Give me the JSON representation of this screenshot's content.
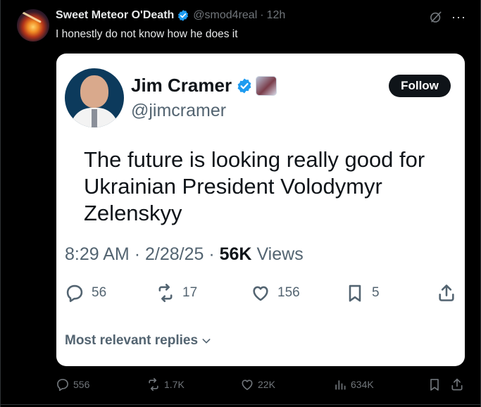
{
  "outer_tweet": {
    "author_name": "Sweet Meteor O'Death",
    "handle": "@smod4real",
    "separator": "·",
    "time": "12h",
    "text": "I honestly do not know how he does it",
    "more_label": "···"
  },
  "quoted_tweet": {
    "author_name": "Jim Cramer",
    "handle": "@jimcramer",
    "follow_label": "Follow",
    "text": "The future is looking really good for Ukrainian President Volodymyr Zelenskyy",
    "time": "8:29 AM",
    "sep1": "·",
    "date": "2/28/25",
    "sep2": "·",
    "views_count": "56K",
    "views_label": "Views",
    "replies": "56",
    "reposts": "17",
    "likes": "156",
    "bookmarks": "5",
    "relevant_label": "Most relevant replies"
  },
  "outer_actions": {
    "replies": "556",
    "reposts": "1.7K",
    "likes": "22K",
    "views": "634K"
  },
  "colors": {
    "background": "#000000",
    "verified_blue": "#1d9bf0",
    "muted_text": "#71767b",
    "card_background": "#ffffff"
  }
}
